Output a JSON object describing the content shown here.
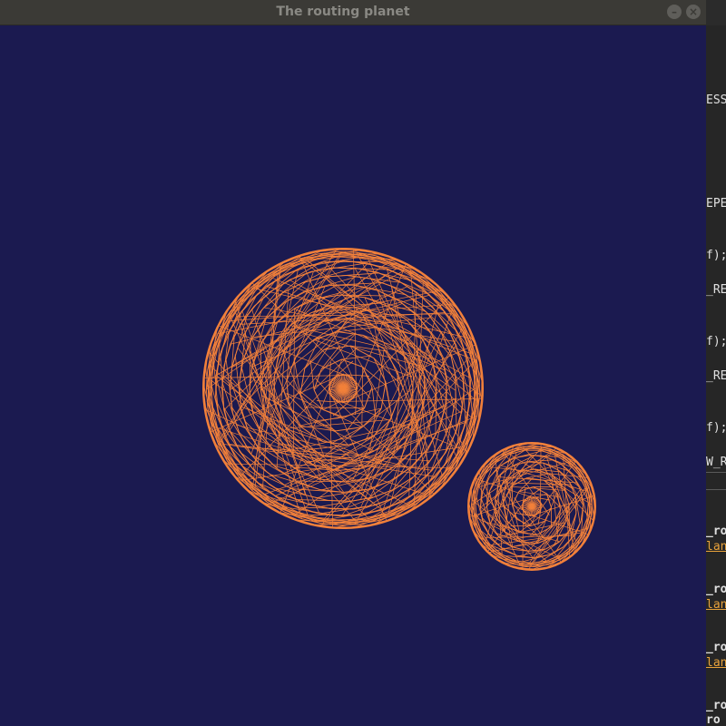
{
  "window": {
    "title": "The routing planet",
    "minimize_icon": "minimize-icon",
    "close_icon": "close-icon",
    "minimize_glyph": "–",
    "close_glyph": "×"
  },
  "scene": {
    "background_color": "#1b1a50",
    "wire_color": "#f2803a",
    "planets": [
      {
        "name": "large-planet",
        "rings": 14,
        "spokes": 48
      },
      {
        "name": "small-planet",
        "rings": 9,
        "spokes": 30
      }
    ]
  },
  "background_editor": {
    "fragments": [
      {
        "text": "ESS",
        "style": "normal"
      },
      {
        "text": "EPE",
        "style": "normal"
      },
      {
        "text": "f);",
        "style": "normal"
      },
      {
        "text": "_RE",
        "style": "normal"
      },
      {
        "text": "f);",
        "style": "normal"
      },
      {
        "text": "_RE",
        "style": "normal"
      },
      {
        "text": "f);",
        "style": "normal"
      },
      {
        "text": "W_R",
        "style": "normal"
      },
      {
        "text": "_ro",
        "style": "bold"
      },
      {
        "text": "lan",
        "style": "link"
      },
      {
        "text": "_ro",
        "style": "bold"
      },
      {
        "text": "lan",
        "style": "link"
      },
      {
        "text": "_ro",
        "style": "bold"
      },
      {
        "text": "lan",
        "style": "link"
      },
      {
        "text": "_ro",
        "style": "bold"
      },
      {
        "text": "ro",
        "style": "bold"
      }
    ]
  }
}
